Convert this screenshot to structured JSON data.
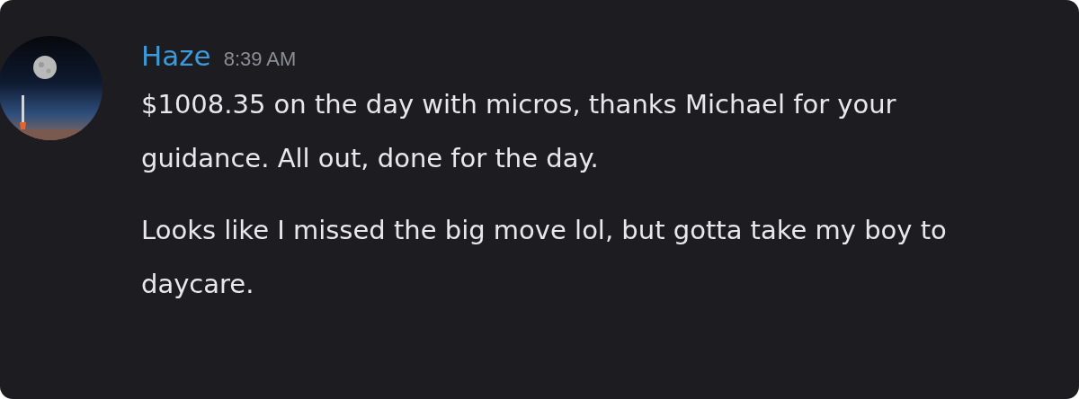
{
  "message": {
    "author": "Haze",
    "timestamp": "8:39 AM",
    "paragraphs": [
      "$1008.35 on the day with micros, thanks Michael for your guidance. All out, done for the day.",
      "Looks like I missed the big move lol, but gotta take my boy to daycare."
    ]
  }
}
